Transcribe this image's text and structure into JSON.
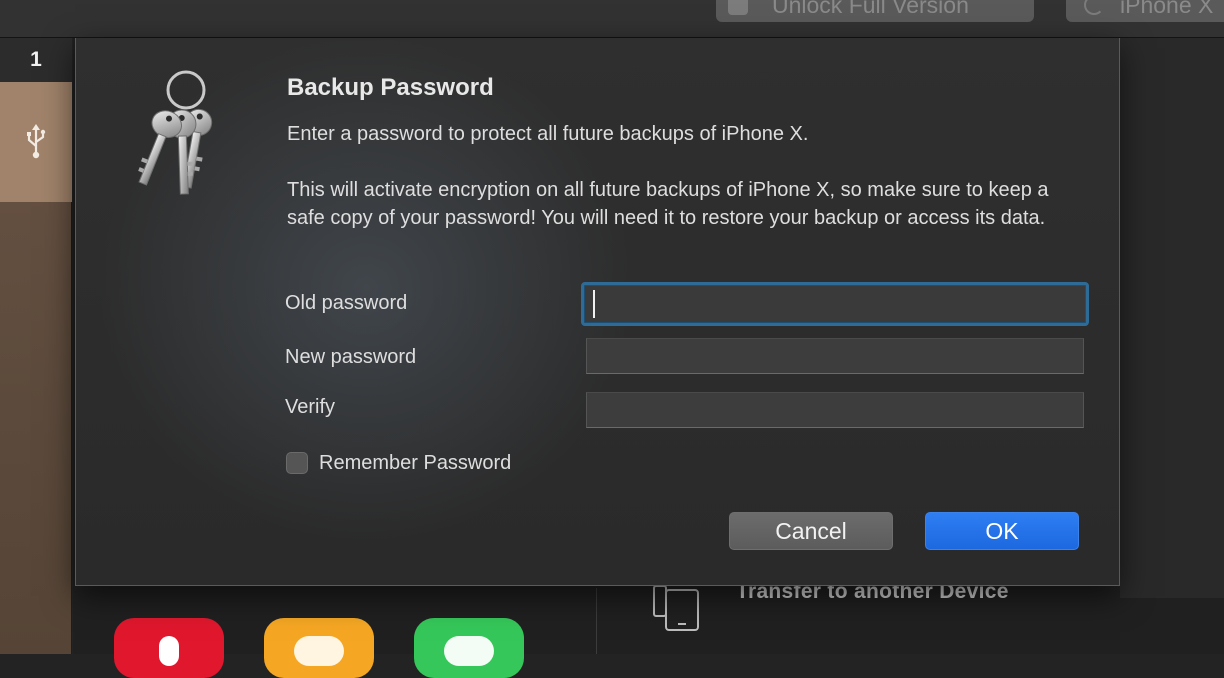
{
  "app": {
    "toolbar": {
      "unlock_label": "Unlock Full Version",
      "device_label": "iPhone X"
    },
    "sidebar": {
      "header_number": "1",
      "device_item_icon": "usb-icon"
    },
    "content": {
      "transfer_label": "Transfer to another Device",
      "transfer_icon": "devices-icon"
    }
  },
  "dialog": {
    "icon": "keychain-keys-icon",
    "title": "Backup Password",
    "message_1": "Enter a password to protect all future backups of iPhone X.",
    "message_2": "This will activate encryption on all future backups of iPhone X, so make sure to keep a safe copy of your password! You will need it to restore your backup or access its data.",
    "fields": {
      "old_label": "Old password",
      "old_value": "",
      "new_label": "New password",
      "new_value": "",
      "verify_label": "Verify",
      "verify_value": ""
    },
    "remember_label": "Remember Password",
    "remember_checked": false,
    "cancel_label": "Cancel",
    "ok_label": "OK",
    "colors": {
      "ok_button": "#1c68e0",
      "focus_ring": "#2e6b96"
    }
  }
}
